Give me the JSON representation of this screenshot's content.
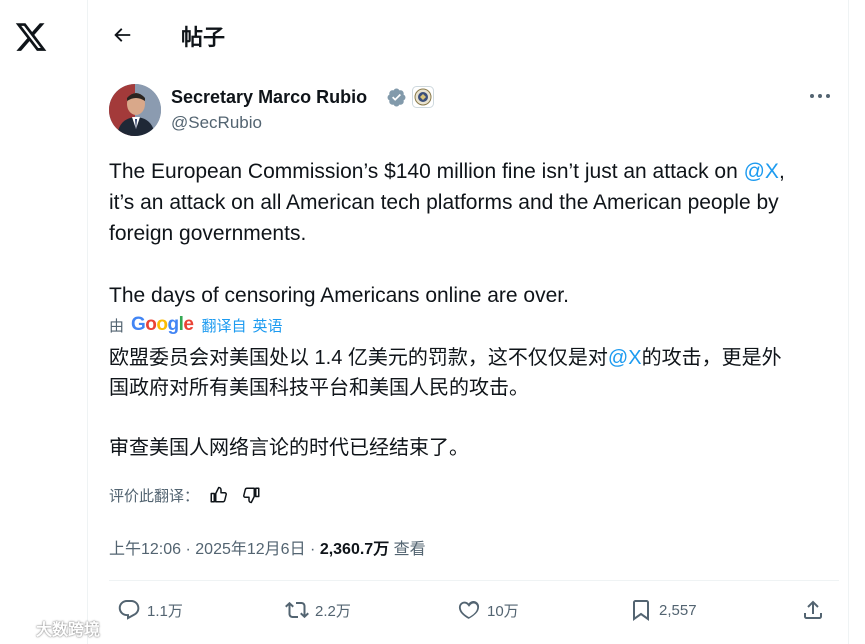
{
  "header": {
    "title": "帖子",
    "back_icon": "back-arrow-icon"
  },
  "sidebar": {
    "logo": "x-logo-icon"
  },
  "tweet": {
    "author_name": "Secretary Marco Rubio",
    "handle": "@SecRubio",
    "badges": [
      "verified-badge-icon",
      "affiliation-seal-icon"
    ],
    "text_line1_a": "The European Commission’s $140 million fine isn’t just an attack on ",
    "text_mention": "@X",
    "text_line1_b": ",",
    "text_line2": "it’s an attack on all American tech platforms and the American people by",
    "text_line3": "foreign governments.",
    "text_line4": "The days of censoring Americans online are over.",
    "translate": {
      "by": "由",
      "google": "Google",
      "translated_from": "翻译自",
      "language": "英语"
    },
    "translated_line1_a": "欧盟委员会对美国处以 1.4 亿美元的罚款，这不仅仅是对",
    "translated_mention": "@X",
    "translated_line1_b": "的攻击，更是外",
    "translated_line2": "国政府对所有美国科技平台和美国人民的攻击。",
    "translated_line3": "审查美国人网络言论的时代已经结束了。",
    "rate_label": "评价此翻译：",
    "time": "上午12:06",
    "sep": "·",
    "date": "2025年12月6日",
    "views_count": "2,360.7万",
    "views_label": "查看"
  },
  "actions": {
    "replies": "1.1万",
    "reposts": "2.2万",
    "likes": "10万",
    "bookmarks": "2,557"
  },
  "watermark": {
    "text": "大数跨境"
  },
  "colors": {
    "accent": "#1d9bf0",
    "text": "#0f1419",
    "muted": "#536471"
  }
}
